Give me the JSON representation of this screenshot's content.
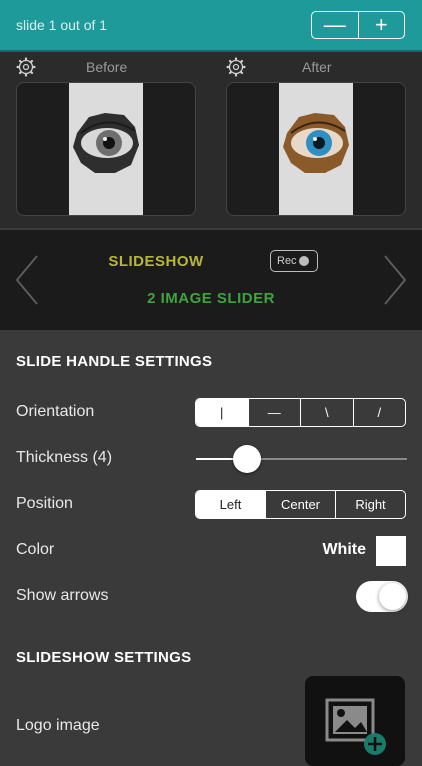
{
  "topbar": {
    "title": "slide 1 out of 1",
    "decrement_label": "—",
    "increment_label": "+"
  },
  "preview": {
    "before_label": "Before",
    "after_label": "After"
  },
  "mode": {
    "title": "SLIDESHOW",
    "rec_label": "Rec",
    "subtitle": "2 IMAGE SLIDER"
  },
  "handle_settings": {
    "title": "SLIDE HANDLE SETTINGS",
    "orientation": {
      "label": "Orientation",
      "options": [
        "|",
        "—",
        "\\",
        "/"
      ],
      "selected": 0
    },
    "thickness": {
      "label": "Thickness (4)",
      "value_fraction": 0.24
    },
    "position": {
      "label": "Position",
      "options": [
        "Left",
        "Center",
        "Right"
      ],
      "selected": 0
    },
    "color": {
      "label": "Color",
      "value": "White",
      "swatch": "#ffffff"
    },
    "show_arrows": {
      "label": "Show arrows",
      "on": true
    }
  },
  "slideshow_settings": {
    "title": "SLIDESHOW SETTINGS",
    "logo_label": "Logo image"
  },
  "colors": {
    "topbar": "#1e9a9a",
    "mode_title": "#b7b73a",
    "mode_subtitle": "#3ea43e"
  }
}
